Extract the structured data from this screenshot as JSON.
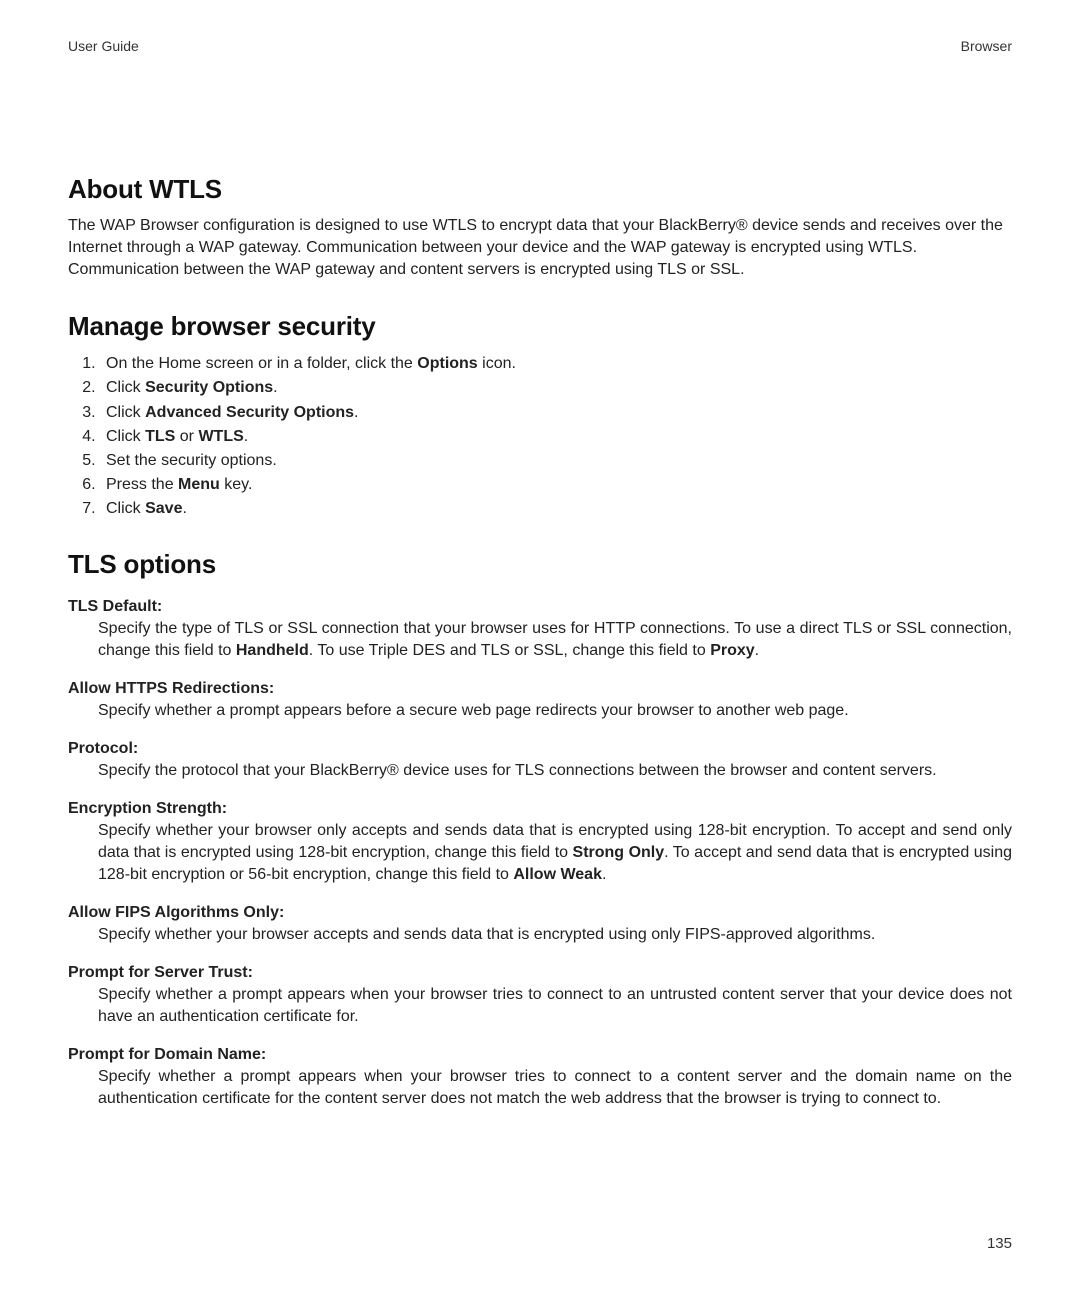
{
  "header": {
    "left": "User Guide",
    "right": "Browser"
  },
  "section_about": {
    "title": "About WTLS",
    "body": "The WAP Browser configuration is designed to use WTLS to encrypt data that your BlackBerry® device sends and receives over the Internet through a WAP gateway. Communication between your device and the WAP gateway is encrypted using WTLS. Communication between the WAP gateway and content servers is encrypted using TLS or SSL."
  },
  "section_manage": {
    "title": "Manage browser security",
    "steps": [
      {
        "pre": "On the Home screen or in a folder, click the ",
        "bold": "Options",
        "post": " icon."
      },
      {
        "pre": "Click ",
        "bold": "Security Options",
        "post": "."
      },
      {
        "pre": "Click ",
        "bold": "Advanced Security Options",
        "post": "."
      },
      {
        "pre": "Click ",
        "bold": "TLS",
        "mid": " or ",
        "bold2": "WTLS",
        "post": "."
      },
      {
        "pre": "Set the security options.",
        "bold": "",
        "post": ""
      },
      {
        "pre": "Press the ",
        "bold": "Menu",
        "post": " key."
      },
      {
        "pre": "Click ",
        "bold": "Save",
        "post": "."
      }
    ]
  },
  "section_tls": {
    "title": "TLS options",
    "options": [
      {
        "term": "TLS Default:",
        "desc_parts": [
          "Specify the type of TLS or SSL connection that your browser uses for HTTP connections. To use a direct TLS or SSL connection, change this field to ",
          "Handheld",
          ". To use Triple DES and TLS or SSL, change this field to ",
          "Proxy",
          "."
        ]
      },
      {
        "term": "Allow HTTPS Redirections:",
        "desc_parts": [
          "Specify whether a prompt appears before a secure web page redirects your browser to another web page."
        ]
      },
      {
        "term": "Protocol:",
        "desc_parts": [
          "Specify the protocol that your BlackBerry® device uses for TLS connections between the browser and content servers."
        ]
      },
      {
        "term": "Encryption Strength:",
        "desc_parts": [
          "Specify whether your browser only accepts and sends data that is encrypted using 128-bit encryption. To accept and send only data that is encrypted using 128-bit encryption, change this field to ",
          "Strong Only",
          ". To accept and send data that is encrypted using 128-bit encryption or 56-bit encryption, change this field to ",
          "Allow Weak",
          "."
        ]
      },
      {
        "term": "Allow FIPS Algorithms Only:",
        "desc_parts": [
          "Specify whether your browser accepts and sends data that is encrypted using only FIPS-approved algorithms."
        ]
      },
      {
        "term": "Prompt for Server Trust:",
        "desc_parts": [
          "Specify whether a prompt appears when your browser tries to connect to an untrusted content server that your device does not have an authentication certificate for."
        ]
      },
      {
        "term": "Prompt for Domain Name:",
        "desc_parts": [
          "Specify whether a prompt appears when your browser tries to connect to a content server and the domain name on the authentication certificate for the content server does not match the web address that the browser is trying to connect to."
        ]
      }
    ]
  },
  "page_number": "135"
}
